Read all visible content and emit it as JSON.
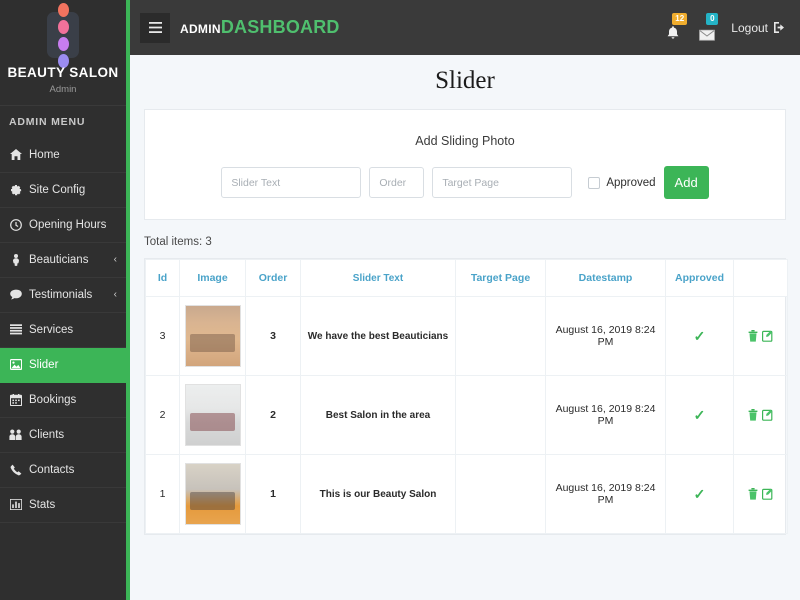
{
  "brand": {
    "logo_icon": "four-dots-logo-icon",
    "title": "BEAUTY SALON",
    "subtitle": "Admin"
  },
  "sidebar": {
    "menu_heading": "ADMIN MENU",
    "items": [
      {
        "label": "Home",
        "icon": "home-icon",
        "active": false,
        "caret": ""
      },
      {
        "label": "Site Config",
        "icon": "gear-icon",
        "active": false,
        "caret": ""
      },
      {
        "label": "Opening Hours",
        "icon": "clock-icon",
        "active": false,
        "caret": ""
      },
      {
        "label": "Beauticians",
        "icon": "person-icon",
        "active": false,
        "caret": "‹"
      },
      {
        "label": "Testimonials",
        "icon": "comment-icon",
        "active": false,
        "caret": "‹"
      },
      {
        "label": "Services",
        "icon": "list-icon",
        "active": false,
        "caret": ""
      },
      {
        "label": "Slider",
        "icon": "image-icon",
        "active": true,
        "caret": ""
      },
      {
        "label": "Bookings",
        "icon": "calendar-icon",
        "active": false,
        "caret": ""
      },
      {
        "label": "Clients",
        "icon": "users-icon",
        "active": false,
        "caret": ""
      },
      {
        "label": "Contacts",
        "icon": "phone-icon",
        "active": false,
        "caret": ""
      },
      {
        "label": "Stats",
        "icon": "bar-chart-icon",
        "active": false,
        "caret": ""
      }
    ]
  },
  "topbar": {
    "menu_toggle_icon": "hamburger-icon",
    "brand_admin": "ADMIN",
    "brand_dashboard": "DASHBOARD",
    "notifications": {
      "icon": "bell-icon",
      "count": "12",
      "color": "#f0ad2e"
    },
    "messages": {
      "icon": "envelope-icon",
      "count": "0",
      "color": "#24b3c6"
    },
    "logout_label": "Logout",
    "logout_icon": "sign-out-icon"
  },
  "page": {
    "title": "Slider",
    "card_subtitle": "Add Sliding Photo",
    "total_items": "Total items: 3"
  },
  "form": {
    "slider_text_placeholder": "Slider Text",
    "order_placeholder": "Order",
    "target_page_placeholder": "Target Page",
    "slider_text_value": "",
    "order_value": "",
    "target_page_value": "",
    "approved_label": "Approved",
    "approved_checked": false,
    "add_label": "Add",
    "add_color": "#3cb557"
  },
  "table": {
    "columns": [
      "Id",
      "Image",
      "Order",
      "Slider Text",
      "Target Page",
      "Datestamp",
      "Approved",
      ""
    ],
    "rows": [
      {
        "id": "3",
        "image": "salon-chair-thumbnail",
        "order": "3",
        "slider_text": "We have the best Beauticians",
        "target_page": "",
        "datestamp": "August 16, 2019 8:24 PM",
        "approved": "✓",
        "delete_icon": "trash-icon",
        "edit_icon": "edit-icon"
      },
      {
        "id": "2",
        "image": "white-salon-thumbnail",
        "order": "2",
        "slider_text": "Best Salon in the area",
        "target_page": "",
        "datestamp": "August 16, 2019 8:24 PM",
        "approved": "✓",
        "delete_icon": "trash-icon",
        "edit_icon": "edit-icon"
      },
      {
        "id": "1",
        "image": "salon-interior-thumbnail",
        "order": "1",
        "slider_text": "This is our Beauty Salon",
        "target_page": "",
        "datestamp": "August 16, 2019 8:24 PM",
        "approved": "✓",
        "delete_icon": "trash-icon",
        "edit_icon": "edit-icon"
      }
    ]
  },
  "colors": {
    "accent_green": "#3cb557",
    "sidebar_bg": "#2f2f2f",
    "topbar_bg": "#3a3a3a",
    "table_header_text": "#4aa3c9",
    "page_bg": "#f4f7fa"
  }
}
